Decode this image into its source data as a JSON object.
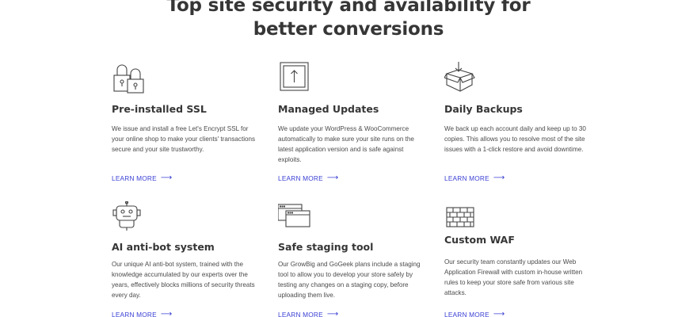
{
  "heading": {
    "line1": "Top site security and availability for",
    "line2": "better conversions"
  },
  "features": [
    {
      "icon": "padlock-icon",
      "title": "Pre-installed SSL",
      "description": "We issue and install a free Let's Encrypt SSL for your online shop to make your clients' transactions secure and your site trustworthy.",
      "link": "LEARN MORE"
    },
    {
      "icon": "update-icon",
      "title": "Managed Updates",
      "description": "We update your WordPress & WooCommerce automatically to make sure your site runs on the latest application version and is safe against exploits.",
      "link": "LEARN MORE"
    },
    {
      "icon": "backup-box-icon",
      "title": "Daily Backups",
      "description": "We back up each account daily and keep up to 30 copies. This allows you to resolve most of the site issues with a 1-click restore and avoid downtime.",
      "link": "LEARN MORE"
    },
    {
      "icon": "bot-icon",
      "title": "AI anti-bot system",
      "description": "Our unique AI anti-bot system, trained with the knowledge accumulated by our experts over the years, effectively blocks millions of security threats every day.",
      "link": "LEARN MORE"
    },
    {
      "icon": "staging-windows-icon",
      "title": "Safe staging tool",
      "description": "Our GrowBig and GoGeek plans include a staging tool to allow you to develop your store safely by testing any changes on a staging copy, before uploading them live.",
      "link": "LEARN MORE"
    },
    {
      "icon": "firewall-icon",
      "title": "Custom WAF",
      "description": "Our security team constantly updates our Web Application Firewall with custom in-house written rules to keep your store safe from various site attacks.",
      "link": "LEARN MORE"
    }
  ],
  "colors": {
    "heading": "#363636",
    "link": "#3a3fd4",
    "icon_stroke": "#444444"
  }
}
